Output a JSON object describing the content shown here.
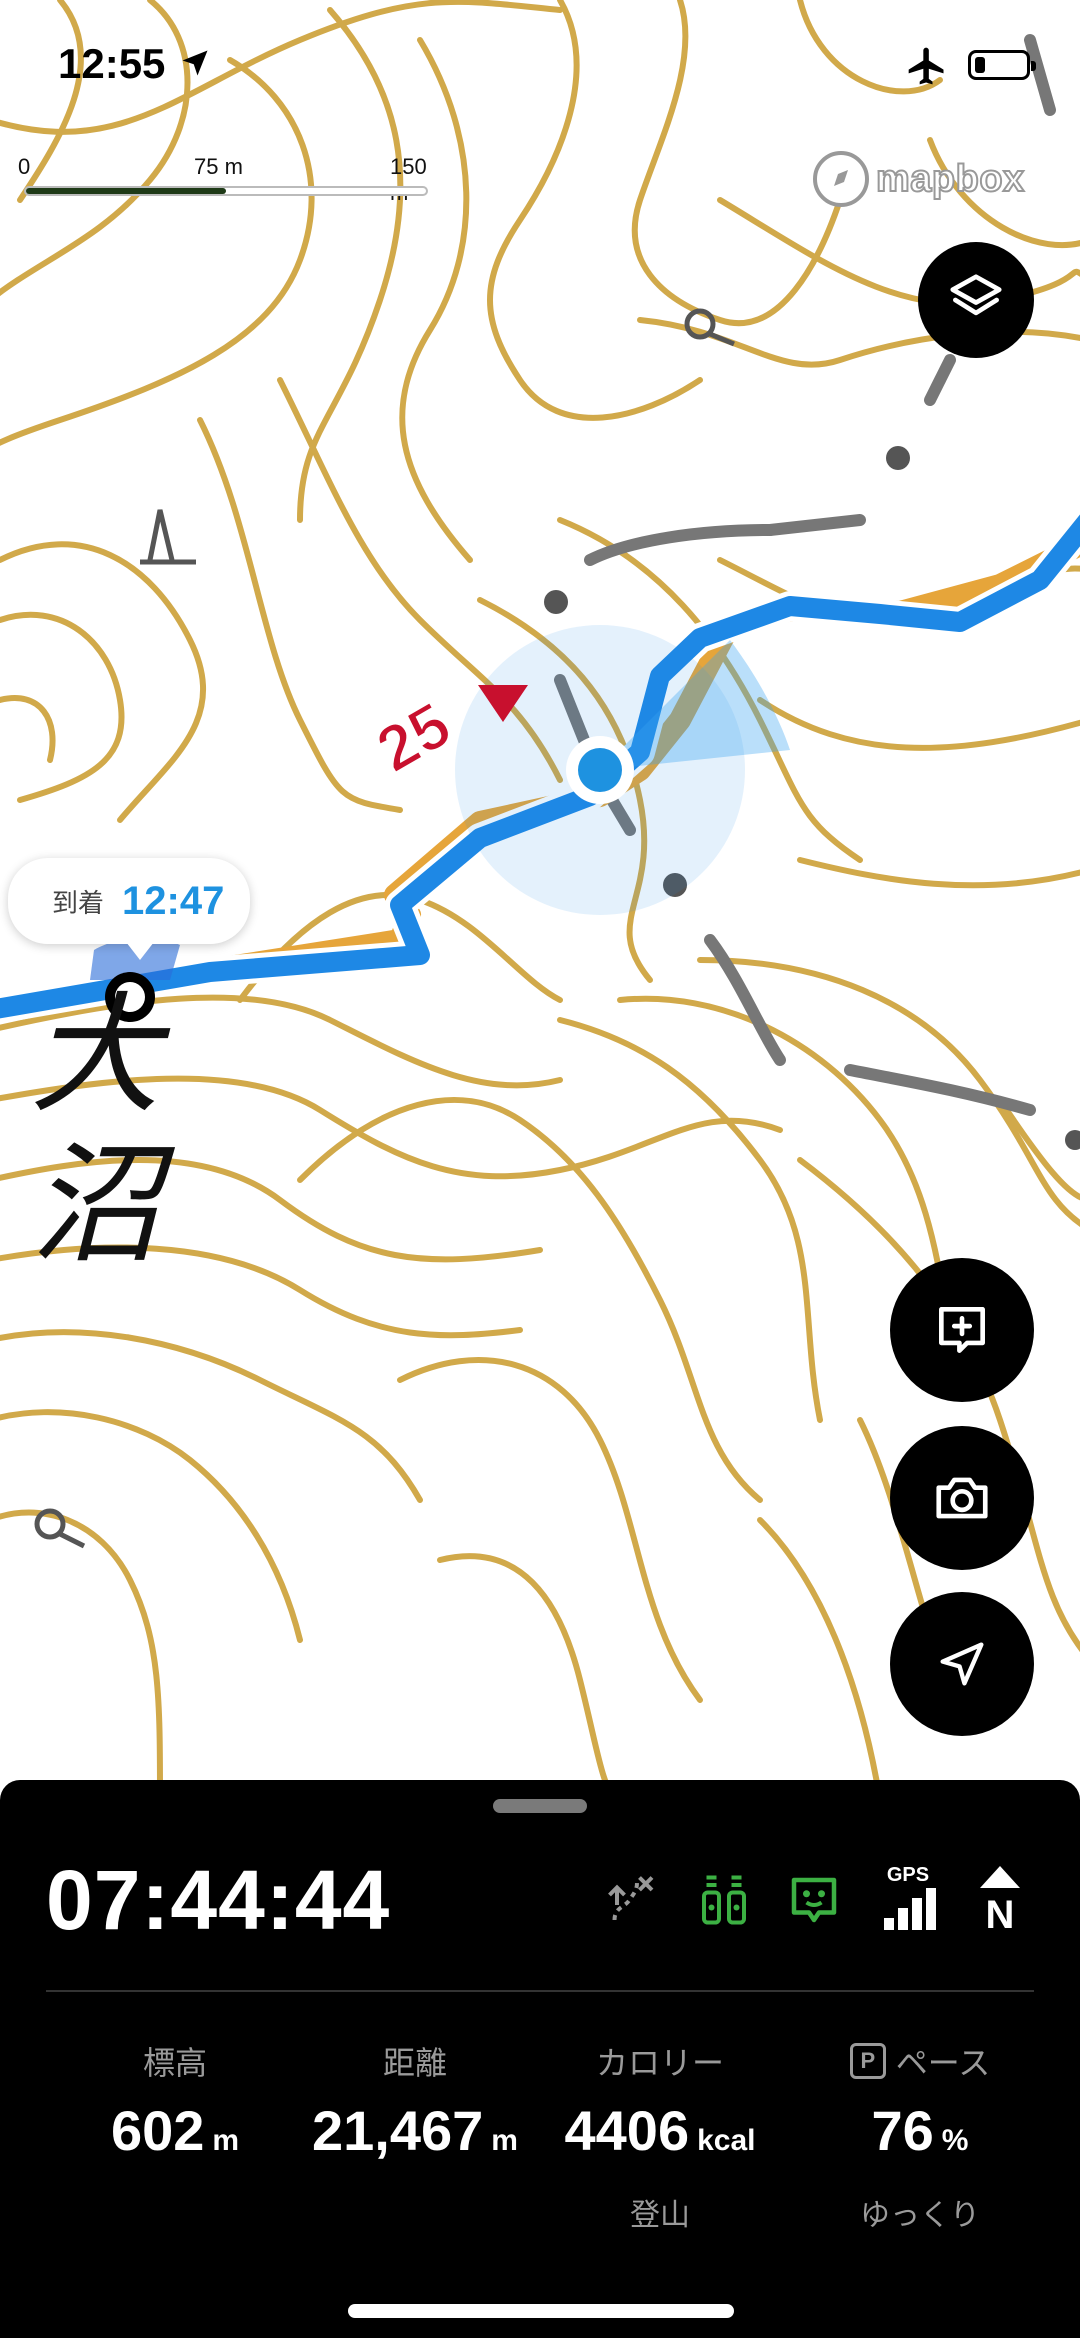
{
  "status_bar": {
    "time": "12:55"
  },
  "map": {
    "scale": {
      "tick_0": "0",
      "tick_mid": "75 m",
      "tick_max": "150 m"
    },
    "attribution": "mapbox",
    "waypoint_number": "25",
    "place_label_line1": "大",
    "place_label_line2": "沼",
    "arrival_bubble": {
      "label": "到着",
      "time": "12:47"
    },
    "colors": {
      "route": "#1e88e5",
      "track": "#e6a53a",
      "contour": "#d1a94a",
      "accent": "#1e92e0",
      "marker": "#c8102e"
    }
  },
  "buttons": {
    "layers": "layers-icon",
    "add_memo": "add-memo-icon",
    "camera": "camera-icon",
    "locate": "locate-arrow-icon"
  },
  "panel": {
    "elapsed_time": "07:44:44",
    "indicator_icons": [
      "route-off-icon",
      "battery-save-icon",
      "pet-status-icon",
      "gps-signal-icon",
      "north-up-icon"
    ],
    "gps_label": "GPS",
    "north_label": "N",
    "stats": {
      "elevation": {
        "label": "標高",
        "value": "602",
        "unit": "m"
      },
      "distance": {
        "label": "距離",
        "value": "21,467",
        "unit": "m"
      },
      "calories": {
        "label": "カロリー",
        "value": "4406",
        "unit": "kcal",
        "sub": "登山"
      },
      "pace": {
        "label_prefix": "P",
        "label": "ペース",
        "value": "76",
        "unit": "%",
        "sub": "ゆっくり"
      }
    }
  }
}
